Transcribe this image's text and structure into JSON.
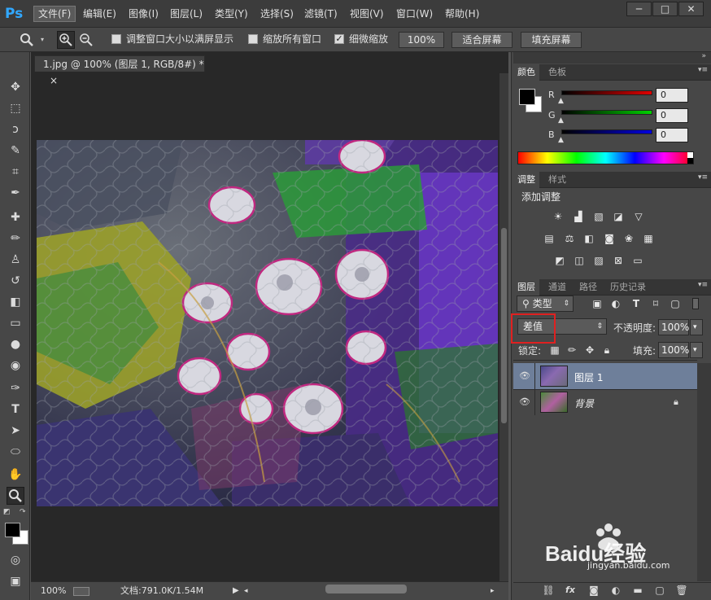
{
  "app": {
    "logo": "Ps"
  },
  "menu": [
    "文件(F)",
    "编辑(E)",
    "图像(I)",
    "图层(L)",
    "类型(Y)",
    "选择(S)",
    "滤镜(T)",
    "视图(V)",
    "窗口(W)",
    "帮助(H)"
  ],
  "window_controls": {
    "minimize": "─",
    "restore": "□",
    "close": "✕"
  },
  "options": {
    "check1_label": "调整窗口大小以满屏显示",
    "check2_label": "缩放所有窗口",
    "check3_label": "细微缩放",
    "btn_100": "100%",
    "btn_fit": "适合屏幕",
    "btn_fill": "填充屏幕"
  },
  "document": {
    "tab_title": "1.jpg @ 100% (图层 1, RGB/8#) *",
    "tab_close": "×",
    "zoom": "100%",
    "doc_info": "文档:791.0K/1.54M"
  },
  "color_panel": {
    "tabs": [
      "颜色",
      "色板"
    ],
    "channels": [
      {
        "label": "R",
        "value": "0",
        "color": "#d01010"
      },
      {
        "label": "G",
        "value": "0",
        "color": "#10c010"
      },
      {
        "label": "B",
        "value": "0",
        "color": "#1010d0"
      }
    ]
  },
  "adjust_panel": {
    "tabs": [
      "调整",
      "样式"
    ],
    "heading": "添加调整"
  },
  "layers_panel": {
    "tabs": [
      "图层",
      "通道",
      "路径",
      "历史记录"
    ],
    "filter_label": "类型",
    "blend_mode": "差值",
    "opacity_label": "不透明度:",
    "opacity_value": "100%",
    "lock_label": "锁定:",
    "fill_label": "填充:",
    "fill_value": "100%",
    "layers": [
      {
        "name": "图层 1",
        "selected": true
      },
      {
        "name": "背景",
        "selected": false
      }
    ]
  },
  "watermark": {
    "brand": "Baidu经验",
    "url": "jingyan.baidu.com"
  }
}
